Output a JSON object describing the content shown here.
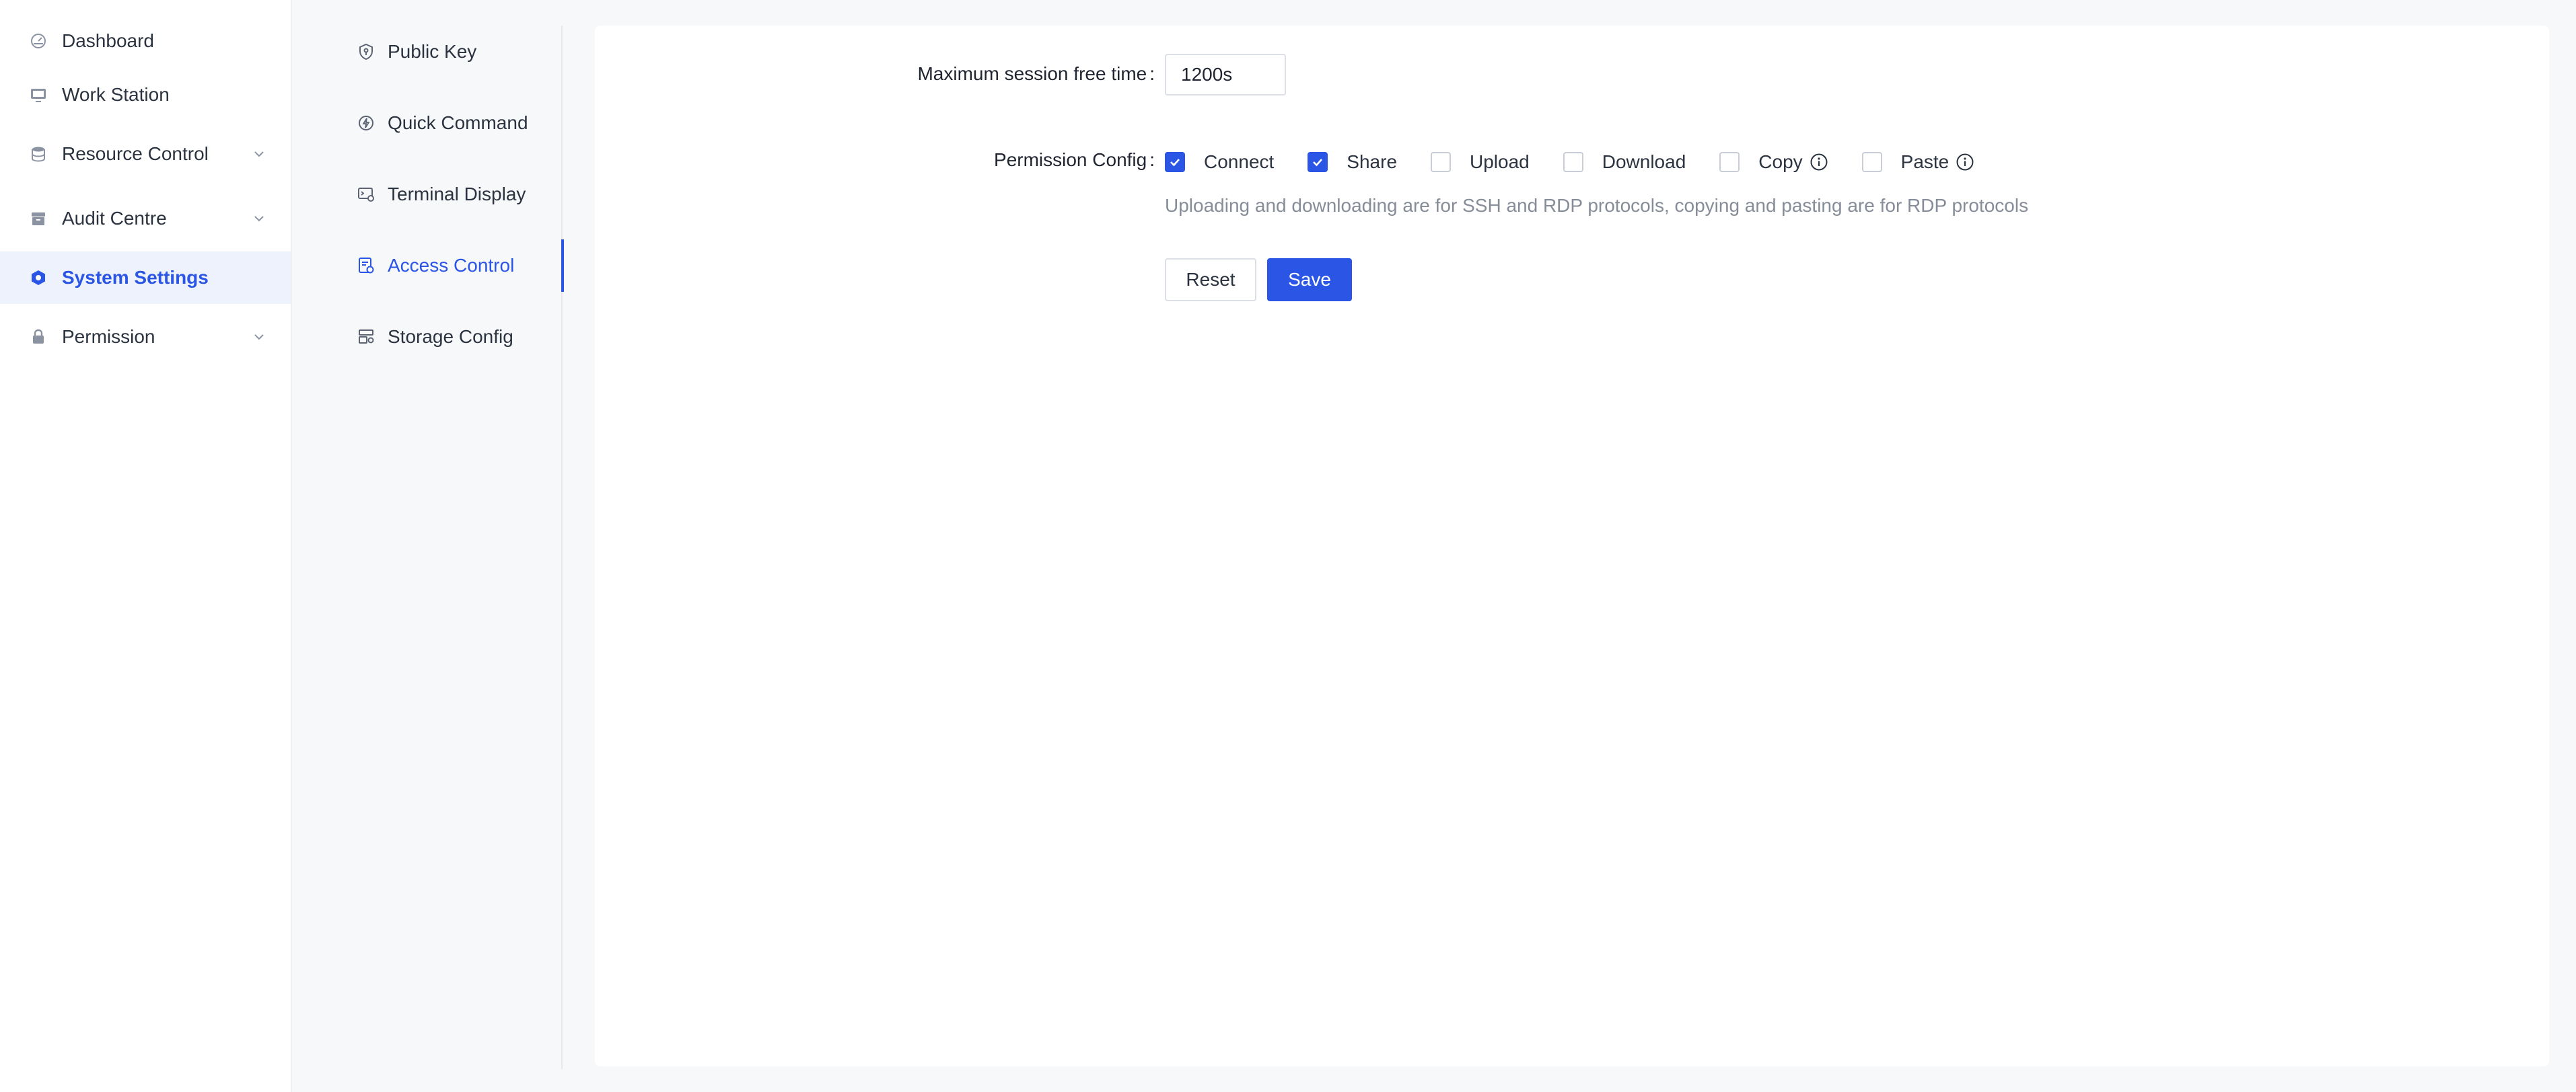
{
  "sidebar": {
    "items": [
      {
        "label": "Dashboard",
        "icon": "dashboard-icon"
      },
      {
        "label": "Work Station",
        "icon": "monitor-icon"
      },
      {
        "label": "Resource Control",
        "icon": "database-icon",
        "expandable": true
      },
      {
        "label": "Audit Centre",
        "icon": "archive-icon",
        "expandable": true
      },
      {
        "label": "System Settings",
        "icon": "hexagon-settings-icon",
        "active": true
      },
      {
        "label": "Permission",
        "icon": "lock-icon",
        "expandable": true
      }
    ]
  },
  "settings_nav": {
    "items": [
      {
        "label": "Public Key",
        "icon": "shield-key-icon"
      },
      {
        "label": "Quick Command",
        "icon": "lightning-icon"
      },
      {
        "label": "Terminal Display",
        "icon": "terminal-display-icon"
      },
      {
        "label": "Access Control",
        "icon": "access-control-icon",
        "active": true
      },
      {
        "label": "Storage Config",
        "icon": "storage-icon"
      }
    ]
  },
  "form": {
    "session_label": "Maximum session free time",
    "session_value": "1200s",
    "permission_label": "Permission Config",
    "permissions": [
      {
        "label": "Connect",
        "checked": true
      },
      {
        "label": "Share",
        "checked": true
      },
      {
        "label": "Upload",
        "checked": false
      },
      {
        "label": "Download",
        "checked": false
      },
      {
        "label": "Copy",
        "checked": false,
        "info": true
      },
      {
        "label": "Paste",
        "checked": false,
        "info": true
      }
    ],
    "hint": "Uploading and downloading are for SSH and RDP protocols, copying and pasting are for RDP protocols",
    "reset_label": "Reset",
    "save_label": "Save"
  },
  "colors": {
    "accent": "#2a55e5",
    "text": "#2c3340",
    "muted": "#868c98"
  }
}
